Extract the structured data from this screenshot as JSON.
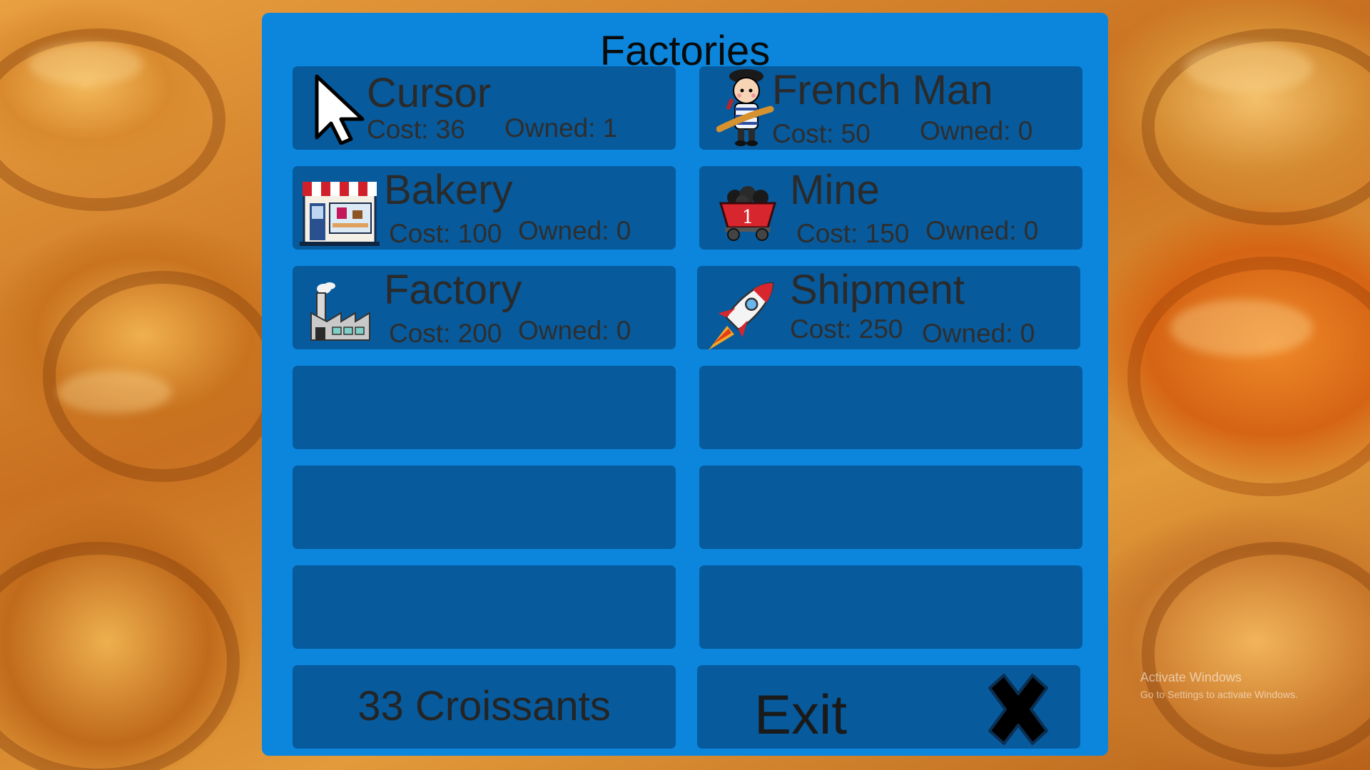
{
  "window": {
    "title": "Factories"
  },
  "items": [
    {
      "name": "Cursor",
      "cost": "Cost: 36",
      "owned": "Owned: 1",
      "icon": "cursor-arrow-icon"
    },
    {
      "name": "French Man",
      "cost": "Cost: 50",
      "owned": "Owned: 0",
      "icon": "french-man-icon"
    },
    {
      "name": "Bakery",
      "cost": "Cost: 100",
      "owned": "Owned: 0",
      "icon": "bakery-storefront-icon"
    },
    {
      "name": "Mine",
      "cost": "Cost: 150",
      "owned": "Owned: 0",
      "icon": "mine-cart-icon"
    },
    {
      "name": "Factory",
      "cost": "Cost: 200",
      "owned": "Owned: 0",
      "icon": "factory-building-icon"
    },
    {
      "name": "Shipment",
      "cost": "Cost: 250",
      "owned": "Owned: 0",
      "icon": "rocket-icon"
    }
  ],
  "footer": {
    "croissants": "33 Croissants",
    "exit_label": "Exit",
    "exit_icon": "close-x-icon"
  },
  "watermark": {
    "line1": "Activate Windows",
    "line2": "Go to Settings to activate Windows."
  },
  "colors": {
    "panel": "#0b86dc",
    "tile": "#075a9c",
    "text": "#2a2a2a"
  }
}
